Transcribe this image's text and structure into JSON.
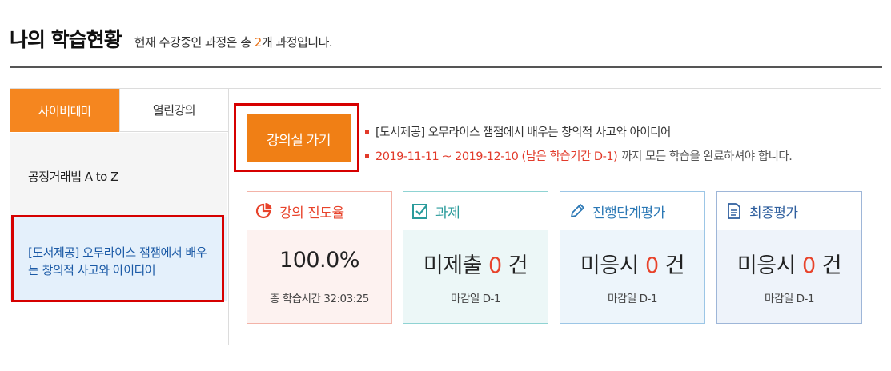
{
  "header": {
    "title": "나의 학습현황",
    "subtitle_prefix": "현재 수강중인 과정은 총 ",
    "course_count": "2",
    "subtitle_suffix": "개 과정입니다."
  },
  "sidebar": {
    "tabs": [
      {
        "label": "사이버테마",
        "active": true
      },
      {
        "label": "열린강의",
        "active": false
      }
    ],
    "courses": [
      {
        "label": "공정거래법 A to Z"
      },
      {
        "label": "[도서제공] 오무라이스 잼잼에서 배우는 창의적 사고와 아이디어"
      }
    ]
  },
  "main": {
    "goto_button": "강의실 가기",
    "course_title": "[도서제공] 오무라이스 잼잼에서 배우는 창의적 사고와 아이디어",
    "period": "2019-11-11 ~ 2019-12-10 (남은 학습기간 D-1)",
    "period_note": "까지 모든 학습을 완료하셔야 합니다."
  },
  "cards": [
    {
      "title": "강의 진도율",
      "value": "100.0%",
      "sub": "총 학습시간 32:03:25",
      "icon": "pie-chart-icon",
      "color": "#e8432b"
    },
    {
      "title": "과제",
      "value_prefix": "미제출 ",
      "count": "0",
      "unit": "건",
      "sub": "마감일 D-1",
      "icon": "checkbox-icon",
      "color": "#2a9b9b"
    },
    {
      "title": "진행단계평가",
      "value_prefix": "미응시 ",
      "count": "0",
      "unit": "건",
      "sub": "마감일 D-1",
      "icon": "pencil-icon",
      "color": "#2b78b5"
    },
    {
      "title": "최종평가",
      "value_prefix": "미응시 ",
      "count": "0",
      "unit": "건",
      "sub": "마감일 D-1",
      "icon": "document-icon",
      "color": "#2f5f9e"
    }
  ]
}
